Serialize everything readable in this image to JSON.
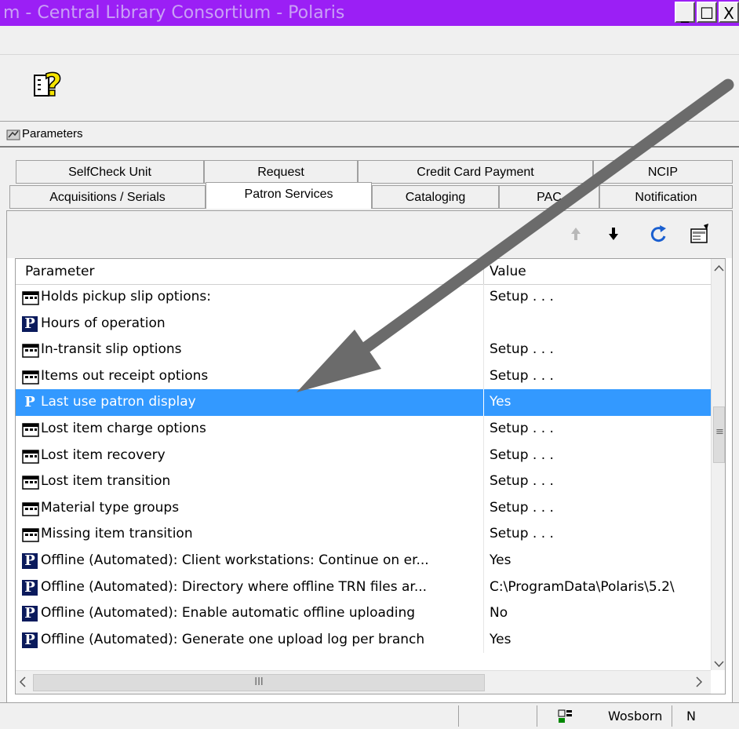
{
  "window": {
    "title": "m - Central Library Consortium - Polaris",
    "buttons": [
      "_",
      "☐",
      "X"
    ]
  },
  "params_bar": {
    "label": "Parameters"
  },
  "tabs_row1": [
    "SelfCheck Unit",
    "Request",
    "Credit Card Payment",
    "NCIP"
  ],
  "tabs_row2": [
    "Acquisitions / Serials",
    "Patron Services",
    "Cataloging",
    "PAC",
    "Notification"
  ],
  "active_tab": "Patron Services",
  "grid": {
    "headers": {
      "parameter": "Parameter",
      "value": "Value"
    },
    "rows": [
      {
        "icon": "dialog-icon",
        "name": "Holds pickup slip options:",
        "value": "Setup . . ."
      },
      {
        "icon": "polaris-p-icon",
        "name": "Hours of operation",
        "value": ""
      },
      {
        "icon": "dialog-icon",
        "name": "In-transit slip options",
        "value": "Setup . . ."
      },
      {
        "icon": "dialog-icon",
        "name": "Items out receipt options",
        "value": "Setup . . ."
      },
      {
        "icon": "polaris-p-icon",
        "name": "Last use patron display",
        "value": "Yes",
        "selected": true
      },
      {
        "icon": "dialog-icon",
        "name": "Lost item charge options",
        "value": "Setup . . ."
      },
      {
        "icon": "dialog-icon",
        "name": "Lost item recovery",
        "value": "Setup . . ."
      },
      {
        "icon": "dialog-icon",
        "name": "Lost item transition",
        "value": "Setup . . ."
      },
      {
        "icon": "dialog-icon",
        "name": "Material type groups",
        "value": "Setup . . ."
      },
      {
        "icon": "dialog-icon",
        "name": "Missing item transition",
        "value": "Setup . . ."
      },
      {
        "icon": "polaris-p-icon",
        "name": "Offline (Automated): Client workstations: Continue on er...",
        "value": "Yes"
      },
      {
        "icon": "polaris-p-icon",
        "name": "Offline (Automated): Directory where offline TRN files ar...",
        "value": "C:\\ProgramData\\Polaris\\5.2\\"
      },
      {
        "icon": "polaris-p-icon",
        "name": "Offline (Automated): Enable automatic offline uploading",
        "value": "No"
      },
      {
        "icon": "polaris-p-icon",
        "name": "Offline (Automated): Generate one upload log per branch",
        "value": "Yes"
      }
    ]
  },
  "scroll": {
    "h_thumb_grip": "III",
    "left_arrow": "<",
    "right_arrow": ">",
    "up_arrow": "^",
    "down_arrow": "v",
    "v_grip": "≡"
  },
  "status": {
    "user": "Wosborn",
    "extra": "N"
  },
  "colors": {
    "titlebar": "#9b1ff5",
    "selection": "#3399ff"
  }
}
